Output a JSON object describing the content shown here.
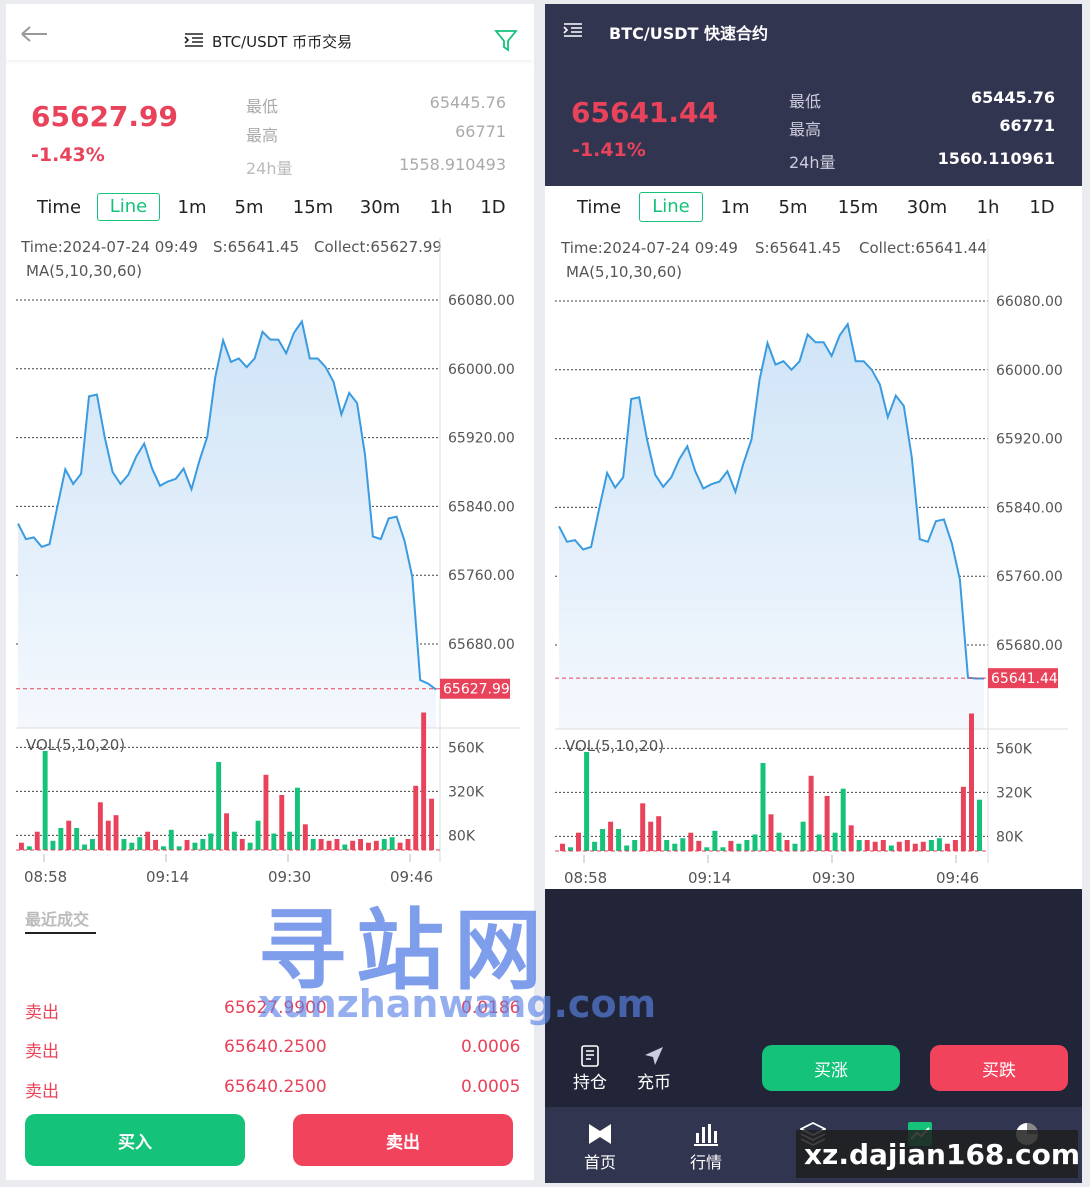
{
  "left": {
    "title": "BTC/USDT 币币交易",
    "price": "65627.99",
    "change": "-1.43%",
    "stats": [
      {
        "label": "最低",
        "value": "65445.76"
      },
      {
        "label": "最高",
        "value": "66771"
      },
      {
        "label": "24h量",
        "value": "1558.910493"
      }
    ],
    "tabs": [
      "Time",
      "Line",
      "1m",
      "5m",
      "15m",
      "30m",
      "1h",
      "1D"
    ],
    "active_tab": "Line",
    "info": {
      "time": "Time:2024-07-24 09:49",
      "s": "S:65641.45",
      "collect": "Collect:65627.99",
      "ma": "MA(5,10,30,60)"
    },
    "y_ticks": [
      "66080.00",
      "66000.00",
      "65920.00",
      "65840.00",
      "65760.00",
      "65680.00"
    ],
    "current_label": "65627.99",
    "vol_label": "VOL(5,10,20)",
    "vol_ticks": [
      "560K",
      "320K",
      "80K"
    ],
    "x_ticks": [
      "08:58",
      "09:14",
      "09:30",
      "09:46"
    ],
    "recent_title": "最近成交",
    "trades": [
      {
        "side": "卖出",
        "price": "65627.9900",
        "amount": "0.0186"
      },
      {
        "side": "卖出",
        "price": "65640.2500",
        "amount": "0.0006"
      },
      {
        "side": "卖出",
        "price": "65640.2500",
        "amount": "0.0005"
      }
    ],
    "buy_label": "买入",
    "sell_label": "卖出"
  },
  "right": {
    "title": "BTC/USDT 快速合约",
    "price": "65641.44",
    "change": "-1.41%",
    "stats": [
      {
        "label": "最低",
        "value": "65445.76"
      },
      {
        "label": "最高",
        "value": "66771"
      },
      {
        "label": "24h量",
        "value": "1560.110961"
      }
    ],
    "tabs": [
      "Time",
      "Line",
      "1m",
      "5m",
      "15m",
      "30m",
      "1h",
      "1D"
    ],
    "info": {
      "time": "Time:2024-07-24 09:49",
      "s": "S:65641.45",
      "collect": "Collect:65641.44",
      "ma": "MA(5,10,30,60)"
    },
    "y_ticks": [
      "66080.00",
      "66000.00",
      "65920.00",
      "65840.00",
      "65760.00",
      "65680.00"
    ],
    "current_label": "65641.44",
    "vol_label": "VOL(5,10,20)",
    "vol_ticks": [
      "560K",
      "320K",
      "80K"
    ],
    "x_ticks": [
      "08:58",
      "09:14",
      "09:30",
      "09:46"
    ],
    "positions_label": "持仓",
    "deposit_label": "充币",
    "buy_up_label": "买涨",
    "buy_down_label": "买跌",
    "nav": [
      "首页",
      "行情",
      "",
      "",
      ""
    ]
  },
  "watermark": {
    "cn": "寻站网",
    "en": "xunzhanwang.com",
    "site": "xz.dajian168.com"
  },
  "colors": {
    "up": "#14c27a",
    "down": "#e8435a",
    "line": "#3a9be0",
    "navy": "#323550"
  },
  "chart_data": [
    {
      "type": "line",
      "title": "",
      "x_ticks": [
        "08:58",
        "09:14",
        "09:30",
        "09:46"
      ],
      "ylim": [
        65620,
        66100
      ],
      "series": [
        {
          "values": [
            65820,
            65802,
            65804,
            65793,
            65796,
            65840,
            65883,
            65866,
            65878,
            65968,
            65970,
            65920,
            65880,
            65866,
            65877,
            65898,
            65913,
            65884,
            65864,
            65869,
            65872,
            65884,
            65860,
            65893,
            65921,
            65990,
            66033,
            66008,
            66012,
            66002,
            66012,
            66043,
            66034,
            66034,
            66018,
            66042,
            66055,
            66012,
            66012,
            66002,
            65985,
            65947,
            65972,
            65960,
            65900,
            65805,
            65802,
            65826,
            65828,
            65800,
            65758,
            65638,
            65634,
            65627
          ]
        }
      ],
      "volume": [
        40,
        20,
        100,
        540,
        50,
        120,
        160,
        120,
        30,
        60,
        260,
        160,
        190,
        60,
        40,
        70,
        100,
        55,
        20,
        110,
        20,
        55,
        40,
        60,
        90,
        480,
        200,
        100,
        60,
        40,
        160,
        410,
        90,
        300,
        100,
        340,
        140,
        60,
        60,
        50,
        60,
        30,
        50,
        60,
        40,
        50,
        60,
        70,
        40,
        60,
        350,
        750,
        280
      ]
    },
    {
      "type": "line",
      "title": "",
      "x_ticks": [
        "08:58",
        "09:14",
        "09:30",
        "09:46"
      ],
      "ylim": [
        65620,
        66100
      ],
      "series": [
        {
          "values": [
            65818,
            65800,
            65802,
            65791,
            65794,
            65838,
            65880,
            65863,
            65875,
            65966,
            65968,
            65918,
            65878,
            65864,
            65875,
            65896,
            65911,
            65882,
            65862,
            65867,
            65870,
            65882,
            65858,
            65891,
            65919,
            65988,
            66031,
            66006,
            66010,
            66000,
            66010,
            66041,
            66032,
            66032,
            66016,
            66040,
            66053,
            66010,
            66010,
            66000,
            65983,
            65945,
            65970,
            65958,
            65898,
            65803,
            65800,
            65824,
            65826,
            65798,
            65756,
            65642,
            65641,
            65641
          ]
        }
      ],
      "volume": [
        40,
        20,
        100,
        540,
        50,
        120,
        160,
        120,
        30,
        60,
        260,
        160,
        190,
        60,
        40,
        70,
        100,
        55,
        20,
        110,
        20,
        55,
        40,
        60,
        90,
        480,
        200,
        100,
        60,
        40,
        160,
        410,
        90,
        300,
        100,
        340,
        140,
        60,
        60,
        50,
        60,
        30,
        50,
        60,
        40,
        50,
        60,
        70,
        40,
        60,
        350,
        750,
        280
      ]
    }
  ]
}
